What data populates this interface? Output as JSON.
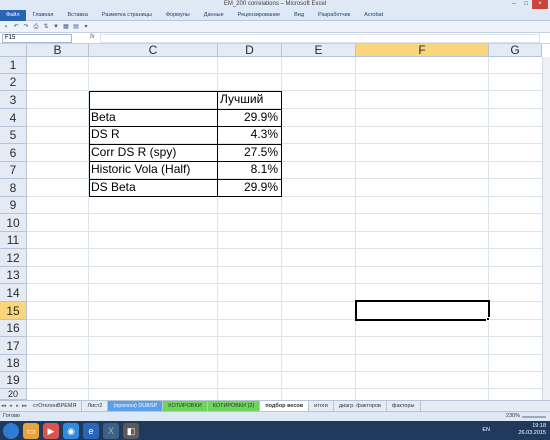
{
  "window": {
    "title": "EM_200 correlations – Microsoft Excel"
  },
  "ribbon_tabs": [
    "Файл",
    "Главная",
    "Вставка",
    "Разметка страницы",
    "Формулы",
    "Данные",
    "Рецензирование",
    "Вид",
    "Разработчик",
    "Acrobat"
  ],
  "formula_bar": {
    "name_box": "F15",
    "fx_label": "fx",
    "formula": ""
  },
  "columns": [
    "B",
    "C",
    "D",
    "E",
    "F",
    "G"
  ],
  "selected_column": "F",
  "rows": [
    "1",
    "2",
    "3",
    "4",
    "5",
    "6",
    "7",
    "8",
    "9",
    "10",
    "11",
    "12",
    "13",
    "14",
    "15",
    "16",
    "17",
    "18",
    "19",
    "20"
  ],
  "selected_row": "15",
  "table": {
    "header": "Лучший",
    "rows": [
      {
        "label": "Beta",
        "value": "29.9%"
      },
      {
        "label": "DS R",
        "value": "4.3%"
      },
      {
        "label": "Corr DS R (spy)",
        "value": "27.5%"
      },
      {
        "label": "Historic Vola (Half)",
        "value": "8.1%"
      },
      {
        "label": "DS Beta",
        "value": "29.9%"
      }
    ]
  },
  "sheet_tabs": [
    {
      "label": "стОтклонВРЕМЯ",
      "style": "normal"
    },
    {
      "label": "Лист2",
      "style": "normal"
    },
    {
      "label": "(прогноз) DUBSP",
      "style": "blue"
    },
    {
      "label": "КОТИРОВКИ",
      "style": "green"
    },
    {
      "label": "КОТИРОВКИ (2)",
      "style": "green"
    },
    {
      "label": "подбор весов",
      "style": "active"
    },
    {
      "label": "итоги",
      "style": "normal"
    },
    {
      "label": "диагр. факторов",
      "style": "normal"
    },
    {
      "label": "факторы",
      "style": "normal"
    }
  ],
  "status": {
    "ready": "Готово",
    "zoom": "230%"
  },
  "taskbar": {
    "lang": "EN",
    "time": "19:18",
    "date": "26.03.2015"
  },
  "colors": {
    "selected_header": "#f9d67c",
    "header_bg": "#e4ebf5",
    "sheet_tab_blue": "#5aa0e8",
    "sheet_tab_green": "#6ed55a"
  }
}
